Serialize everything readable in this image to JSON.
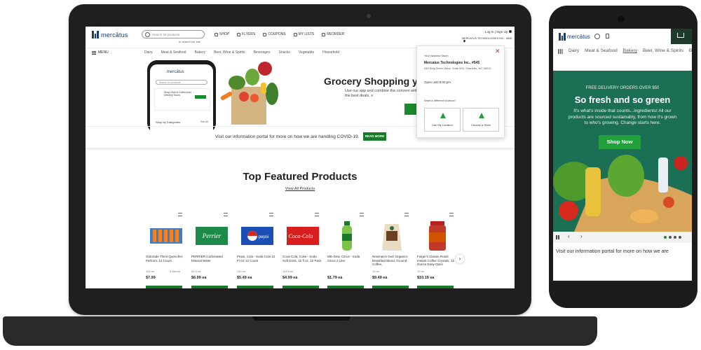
{
  "desktop": {
    "logo_text": "mercātus",
    "search": {
      "placeholder": "Search for products",
      "sub": "or search our site"
    },
    "nav": [
      {
        "label": "SHOP"
      },
      {
        "label": "FLYERS"
      },
      {
        "label": "COUPONS"
      },
      {
        "label": "MY LISTS"
      },
      {
        "label": "REORDER"
      }
    ],
    "login": "Log In | Sign Up",
    "store_line": "MERCATUS TECHNOLOGIES INC., #545",
    "menu_label": "MENU",
    "categories": [
      "Dairy",
      "Meat & Seafood",
      "Bakery",
      "Beer, Wine & Spirits",
      "Beverages",
      "Snacks",
      "Vegetable",
      "Household"
    ],
    "hero": {
      "title": "Grocery Shopping y",
      "subtitle": "Use our app and combine the conveni with the best deals, s"
    },
    "phone_mock": {
      "logo": "mercātus",
      "search": "Search for products",
      "banner": "Shop Click & Collect and Delivery Hours",
      "shop_by": "Shop by Categories",
      "see_all": "See All"
    },
    "covid": {
      "text": "Visit our information portal for more on how we are handling COVID-19.",
      "button": "READ MORE"
    },
    "store_popup": {
      "close": "✕",
      "label": "Your Nearest Store:",
      "name": "Mercatus Technologies Inc., #545",
      "address": "545 King Street West, Suite 500, Charlotte, NC 28210",
      "hours": "Open until 9:00 pm",
      "want_different": "Want a different location?",
      "use_location": "Use My Location",
      "choose_store": "Choose a Store"
    },
    "featured": {
      "title": "Top Featured Products",
      "view_all": "View All Products"
    },
    "products": [
      {
        "name": "Gatorade Thirst Quencher, Perform, 12 Count",
        "size": "144 oz",
        "flavors": "5 flavors",
        "price": "$7.99"
      },
      {
        "name": "PERRIER Carbonated Mineral Water",
        "size": "84.5 oz",
        "flavors": "",
        "price": "$6.99 ea"
      },
      {
        "name": "Pepsi, Cola - Soda Cola 12 Fl Oz 12 Count",
        "size": "144 oz",
        "flavors": "",
        "price": "$5.49 ea"
      },
      {
        "name": "Coca-Cola, Coke - Soda Soft Drink, 12 fl oz, 12 Pack",
        "size": "144 fl oz",
        "flavors": "",
        "price": "$4.99 ea"
      },
      {
        "name": "Mtn Dew, Citrus - Soda Citrus 2 Liter",
        "size": "",
        "flavors": "",
        "price": "$1.79 ea"
      },
      {
        "name": "Newman's Own Organics Breakfast Blend, Ground Coffee,",
        "size": "10 oz",
        "flavors": "",
        "price": "$9.49 ea"
      },
      {
        "name": "Folger's Classic Roast Instant Coffee Crystals, 12 Ounce Easy-Open",
        "size": "12 oz",
        "flavors": "",
        "price": "$10.19 ea"
      }
    ],
    "next": "›"
  },
  "mobile": {
    "logo_text": "mercātus",
    "categories": [
      "Dairy",
      "Meat & Seafood",
      "Bakery",
      "Beer, Wine & Spirits",
      "Be"
    ],
    "hero": {
      "free": "FREE DELIVERY ORDERS OVER $50",
      "title": "So fresh and so green",
      "body": "It's what's inside that counts...ingredients! All our products are sourced sustainably, from how it's grown to who's growing. Change starts here.",
      "button": "Shop Now"
    },
    "carousel": {
      "prev": "‹",
      "next": "›"
    },
    "covid": "Visit our information portal for more on how we are"
  },
  "colors": {
    "brand_green": "#1a7a2c",
    "hero_green": "#1b6f54",
    "brand_blue": "#1d3c6e",
    "device": "#1f1f1f"
  }
}
